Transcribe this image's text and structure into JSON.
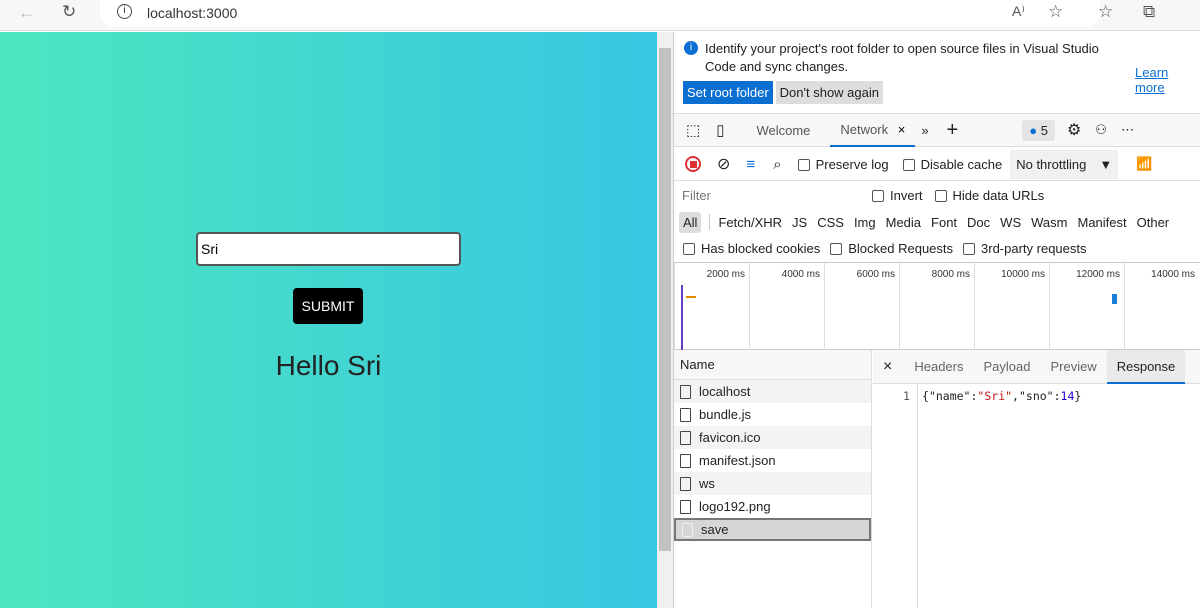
{
  "browser": {
    "url": "localhost:3000",
    "icons": [
      "back-icon",
      "refresh-icon",
      "info-icon",
      "read-aloud-icon",
      "favorite-add-icon",
      "favorites-icon",
      "collections-icon"
    ]
  },
  "page": {
    "input_value": "Sri",
    "submit_label": "SUBMIT",
    "greeting": "Hello Sri",
    "gradient": [
      "#4de6bf",
      "#38c6e2"
    ]
  },
  "devtools": {
    "infobar": {
      "message": "Identify your project's root folder to open source files in Visual Studio Code and sync changes.",
      "learn_more": "Learn more",
      "set_root": "Set root folder",
      "dont_show": "Don't show again"
    },
    "tabs": [
      {
        "label": "Welcome"
      },
      {
        "label": "Network",
        "active": true
      }
    ],
    "issues_count": "5",
    "toolbar": {
      "preserve_log": "Preserve log",
      "disable_cache": "Disable cache",
      "throttling": "No throttling"
    },
    "filter": {
      "placeholder": "Filter",
      "invert": "Invert",
      "hide_data_urls": "Hide data URLs"
    },
    "types": [
      "All",
      "Fetch/XHR",
      "JS",
      "CSS",
      "Img",
      "Media",
      "Font",
      "Doc",
      "WS",
      "Wasm",
      "Manifest",
      "Other"
    ],
    "checks": [
      "Has blocked cookies",
      "Blocked Requests",
      "3rd-party requests"
    ],
    "timeline": [
      "2000 ms",
      "4000 ms",
      "6000 ms",
      "8000 ms",
      "10000 ms",
      "12000 ms",
      "14000 ms"
    ],
    "name_header": "Name",
    "requests": [
      "localhost",
      "bundle.js",
      "favicon.ico",
      "manifest.json",
      "ws",
      "logo192.png",
      "save"
    ],
    "selected_request": "save",
    "detail_tabs": [
      "Headers",
      "Payload",
      "Preview",
      "Response"
    ],
    "active_detail_tab": "Response",
    "response": {
      "line": "1",
      "open": "{",
      "k1": "\"name\"",
      "v1": "\"Sri\"",
      "k2": "\"sno\"",
      "v2": "14",
      "close": "}",
      "colon": ":",
      "comma": ","
    }
  }
}
